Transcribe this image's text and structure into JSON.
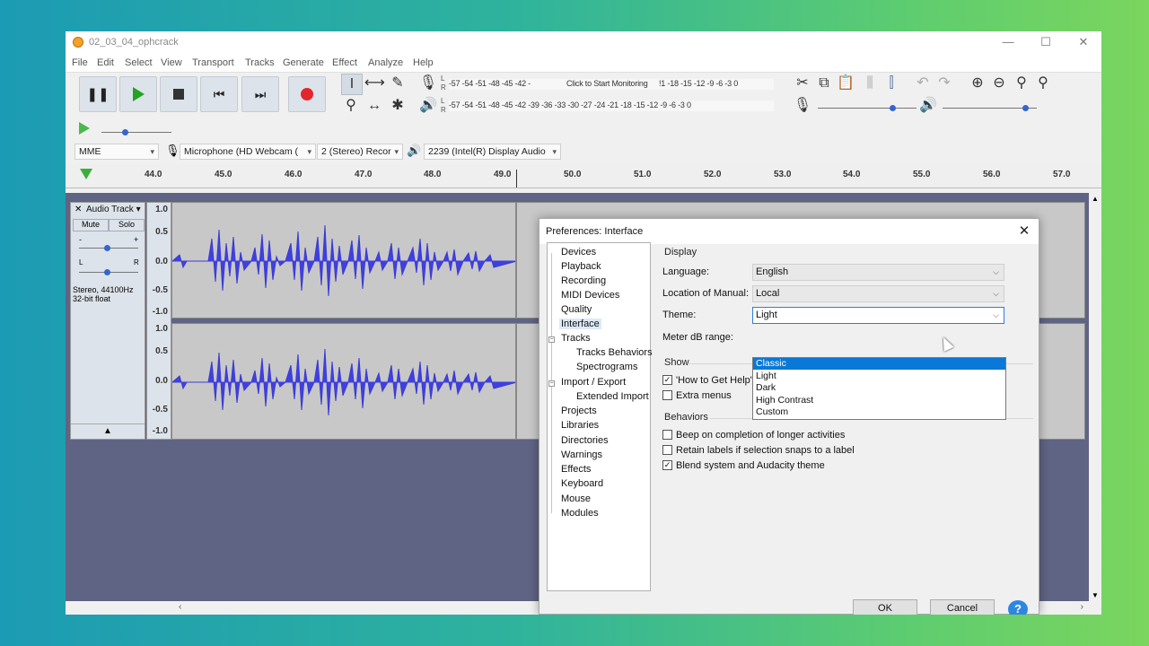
{
  "window": {
    "title": "02_03_04_ophcrack",
    "controls": [
      "—",
      "☐",
      "✕"
    ]
  },
  "menu": [
    "File",
    "Edit",
    "Select",
    "View",
    "Transport",
    "Tracks",
    "Generate",
    "Effect",
    "Analyze",
    "Help"
  ],
  "meters": {
    "record_scale": "-57 -54 -51 -48 -45 -42 -⁠",
    "record_click": "Click to Start Monitoring",
    "record_tail": "!1 -18 -15 -12 -9 -6 -3 0",
    "playback_scale": "-57 -54 -51 -48 -45 -42 -39 -36 -33 -30 -27 -24 -21 -18 -15 -12 -9 -6 -3 0",
    "l": "L",
    "r": "R"
  },
  "device_toolbar": {
    "host": "MME",
    "input": "Microphone (HD Webcam (",
    "channels": "2 (Stereo) Recor",
    "output": "2239 (Intel(R) Display Audio"
  },
  "ruler": [
    "44.0",
    "45.0",
    "46.0",
    "47.0",
    "48.0",
    "49.0",
    "50.0",
    "51.0",
    "52.0",
    "53.0",
    "54.0",
    "55.0",
    "56.0",
    "57.0"
  ],
  "track": {
    "name": "Audio Track",
    "mute": "Mute",
    "solo": "Solo",
    "minus": "-",
    "plus": "+",
    "l": "L",
    "r": "R",
    "info1": "Stereo, 44100Hz",
    "info2": "32-bit float",
    "scale": [
      "1.0",
      "0.5",
      "0.0",
      "-0.5",
      "-1.0"
    ]
  },
  "dialog": {
    "title": "Preferences: Interface",
    "tree": [
      "Devices",
      "Playback",
      "Recording",
      "MIDI Devices",
      "Quality",
      "Interface",
      "Tracks",
      "Tracks Behaviors",
      "Spectrograms",
      "Import / Export",
      "Extended Import",
      "Projects",
      "Libraries",
      "Directories",
      "Warnings",
      "Effects",
      "Keyboard",
      "Mouse",
      "Modules"
    ],
    "display_section": "Display",
    "language_label": "Language:",
    "language_value": "English",
    "manual_label": "Location of Manual:",
    "manual_value": "Local",
    "theme_label": "Theme:",
    "theme_value": "Light",
    "meter_label": "Meter dB range:",
    "theme_options": [
      "Classic",
      "Light",
      "Dark",
      "High Contrast",
      "Custom"
    ],
    "show_section": "Show",
    "show_help": "'How to Get Help'",
    "extra_menus": "Extra menus",
    "behaviors_section": "Behaviors",
    "beep": "Beep on completion of longer activities",
    "retain": "Retain labels if selection snaps to a label",
    "blend": "Blend system and Audacity theme",
    "ok": "OK",
    "cancel": "Cancel",
    "help": "?"
  },
  "colors": {
    "accent": "#0a78d7",
    "waveform": "#3b3bd6",
    "workspace": "#5f6484"
  }
}
